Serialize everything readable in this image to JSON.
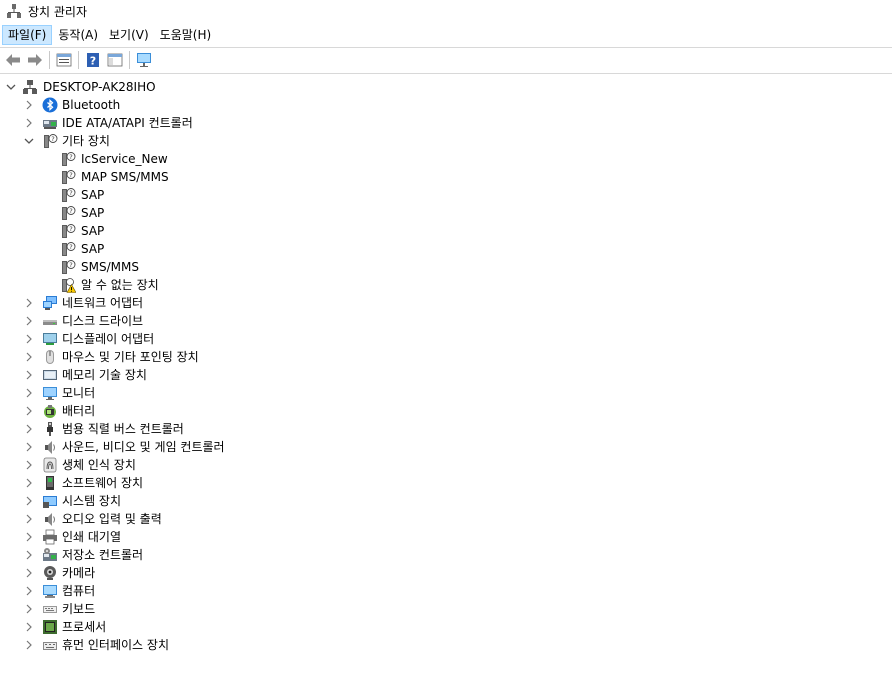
{
  "window": {
    "title": "장치 관리자"
  },
  "menu": [
    {
      "label": "파일(F)",
      "active": true
    },
    {
      "label": "동작(A)",
      "active": false
    },
    {
      "label": "보기(V)",
      "active": false
    },
    {
      "label": "도움말(H)",
      "active": false
    }
  ],
  "toolbar": [
    {
      "icon": "back-arrow-icon",
      "type": "btn"
    },
    {
      "icon": "forward-arrow-icon",
      "type": "btn"
    },
    {
      "type": "sep"
    },
    {
      "icon": "properties-icon",
      "type": "btn"
    },
    {
      "type": "sep"
    },
    {
      "icon": "help-icon",
      "type": "btn"
    },
    {
      "icon": "show-hide-console-tree-icon",
      "type": "btn"
    },
    {
      "type": "sep"
    },
    {
      "icon": "monitor-scan-icon",
      "type": "btn"
    }
  ],
  "tree": [
    {
      "label": "DESKTOP-AK28IHO",
      "level": 0,
      "expander": "expanded",
      "icon": "computer-root-icon"
    },
    {
      "label": "Bluetooth",
      "level": 1,
      "expander": "collapsed",
      "icon": "bluetooth-icon"
    },
    {
      "label": "IDE ATA/ATAPI 컨트롤러",
      "level": 1,
      "expander": "collapsed",
      "icon": "ide-controller-icon"
    },
    {
      "label": "기타 장치",
      "level": 1,
      "expander": "expanded",
      "icon": "unknown-device-icon"
    },
    {
      "label": "IcService_New",
      "level": 2,
      "expander": "none",
      "icon": "unknown-device-icon"
    },
    {
      "label": "MAP SMS/MMS",
      "level": 2,
      "expander": "none",
      "icon": "unknown-device-icon"
    },
    {
      "label": "SAP",
      "level": 2,
      "expander": "none",
      "icon": "unknown-device-icon"
    },
    {
      "label": "SAP",
      "level": 2,
      "expander": "none",
      "icon": "unknown-device-icon"
    },
    {
      "label": "SAP",
      "level": 2,
      "expander": "none",
      "icon": "unknown-device-icon"
    },
    {
      "label": "SAP",
      "level": 2,
      "expander": "none",
      "icon": "unknown-device-icon"
    },
    {
      "label": "SMS/MMS",
      "level": 2,
      "expander": "none",
      "icon": "unknown-device-icon"
    },
    {
      "label": "알 수 없는 장치",
      "level": 2,
      "expander": "none",
      "icon": "warning-device-icon"
    },
    {
      "label": "네트워크 어댑터",
      "level": 1,
      "expander": "collapsed",
      "icon": "network-adapter-icon"
    },
    {
      "label": "디스크 드라이브",
      "level": 1,
      "expander": "collapsed",
      "icon": "disk-drive-icon"
    },
    {
      "label": "디스플레이 어댑터",
      "level": 1,
      "expander": "collapsed",
      "icon": "display-adapter-icon"
    },
    {
      "label": "마우스 및 기타 포인팅 장치",
      "level": 1,
      "expander": "collapsed",
      "icon": "mouse-icon"
    },
    {
      "label": "메모리 기술 장치",
      "level": 1,
      "expander": "collapsed",
      "icon": "memory-device-icon"
    },
    {
      "label": "모니터",
      "level": 1,
      "expander": "collapsed",
      "icon": "monitor-icon"
    },
    {
      "label": "배터리",
      "level": 1,
      "expander": "collapsed",
      "icon": "battery-icon"
    },
    {
      "label": "범용 직렬 버스 컨트롤러",
      "level": 1,
      "expander": "collapsed",
      "icon": "usb-icon"
    },
    {
      "label": "사운드, 비디오 및 게임 컨트롤러",
      "level": 1,
      "expander": "collapsed",
      "icon": "speaker-icon"
    },
    {
      "label": "생체 인식 장치",
      "level": 1,
      "expander": "collapsed",
      "icon": "fingerprint-icon"
    },
    {
      "label": "소프트웨어 장치",
      "level": 1,
      "expander": "collapsed",
      "icon": "software-device-icon"
    },
    {
      "label": "시스템 장치",
      "level": 1,
      "expander": "collapsed",
      "icon": "system-device-icon"
    },
    {
      "label": "오디오 입력 및 출력",
      "level": 1,
      "expander": "collapsed",
      "icon": "speaker-icon"
    },
    {
      "label": "인쇄 대기열",
      "level": 1,
      "expander": "collapsed",
      "icon": "printer-icon"
    },
    {
      "label": "저장소 컨트롤러",
      "level": 1,
      "expander": "collapsed",
      "icon": "storage-controller-icon"
    },
    {
      "label": "카메라",
      "level": 1,
      "expander": "collapsed",
      "icon": "camera-icon"
    },
    {
      "label": "컴퓨터",
      "level": 1,
      "expander": "collapsed",
      "icon": "computer-icon"
    },
    {
      "label": "키보드",
      "level": 1,
      "expander": "collapsed",
      "icon": "keyboard-icon"
    },
    {
      "label": "프로세서",
      "level": 1,
      "expander": "collapsed",
      "icon": "processor-icon"
    },
    {
      "label": "휴먼 인터페이스 장치",
      "level": 1,
      "expander": "collapsed",
      "icon": "hid-icon"
    }
  ]
}
